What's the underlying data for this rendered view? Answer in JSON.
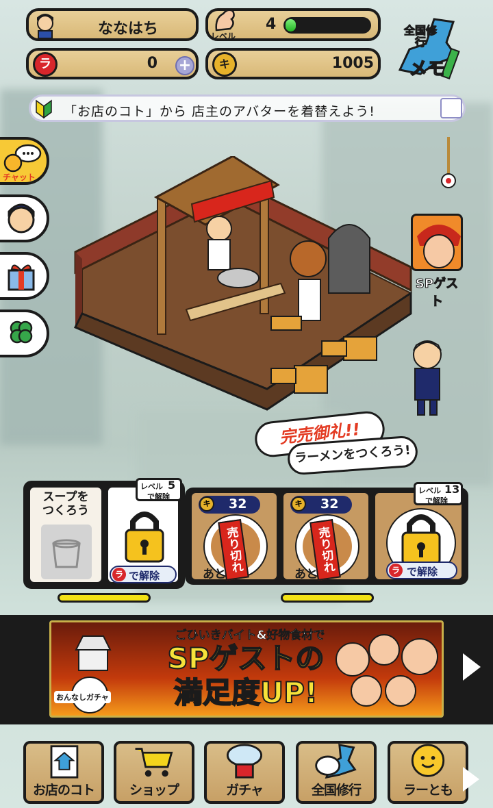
{
  "header": {
    "player_name": "ななはち",
    "level_label": "レベル",
    "level": "4",
    "level_progress": 0.12,
    "premium_currency": "0",
    "coins": "1005",
    "memo_logo_top": "全国修行",
    "memo_logo_bottom": "メモ"
  },
  "banner_tip": {
    "text": "「お店のコト」から 店主のアバターを着替えよう!"
  },
  "side_menu": {
    "chat_label": "チャット"
  },
  "sp_guest": {
    "label": "SPゲスト"
  },
  "speech": {
    "line1": "完売御礼!!",
    "line2": "ラーメンをつくろう!"
  },
  "cards": {
    "soup_title": "スープを\nつくろう",
    "lock1_level_label": "レベル",
    "lock1_level": "5",
    "lock1_unlock_suffix": "で解除",
    "unlock_button": "で解除",
    "bowl1_price": "32",
    "bowl2_price": "32",
    "soldout_text": "売り切れ",
    "bowl_left_text": "あと",
    "lock2_level_label": "レベル",
    "lock2_level": "13",
    "lock2_unlock_suffix": "で解除"
  },
  "ad_banner": {
    "line_top": "ごひいきバイト&好物食材で",
    "line_main1": "SPゲストの",
    "line_main2": "満足度UP!",
    "gacha_tag": "おんなしガチャ"
  },
  "bottom_nav": {
    "items": [
      {
        "label": "お店のコト",
        "icon": "shop-icon"
      },
      {
        "label": "ショップ",
        "icon": "cart-icon"
      },
      {
        "label": "ガチャ",
        "icon": "gacha-icon"
      },
      {
        "label": "全国修行",
        "icon": "map-icon"
      },
      {
        "label": "ラーとも",
        "icon": "friend-icon"
      }
    ]
  },
  "colors": {
    "wood": "#d9b978",
    "accent_green": "#22b424",
    "navy": "#1f2a6b",
    "red": "#d21f1f",
    "yellow": "#f3e215"
  }
}
